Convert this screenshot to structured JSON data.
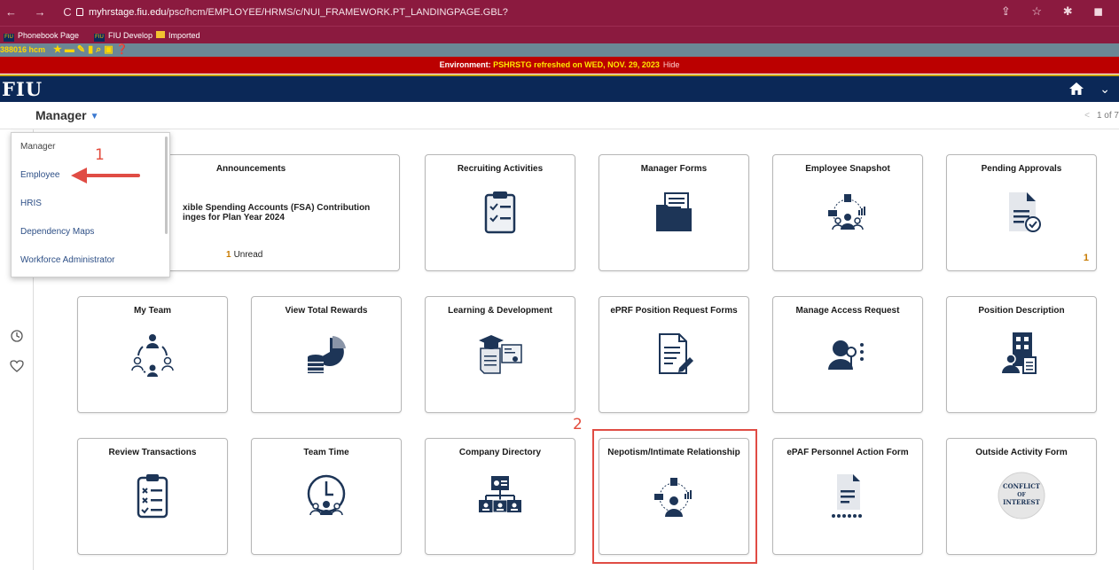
{
  "browser": {
    "nav": "← → C",
    "url_host": "myhrstage.fiu.edu",
    "url_path": "/psc/hcm/EMPLOYEE/HRMS/c/NUI_FRAMEWORK.PT_LANDINGPAGE.GBL?",
    "actions": "⇪ ☆ ✱ ◼",
    "bookmarks": [
      {
        "label": "Phonebook Page",
        "icon": "fiu-icon"
      },
      {
        "label": "FIU Develop",
        "icon": "fiu-icon"
      },
      {
        "label": "Imported",
        "icon": "folder-icon"
      }
    ],
    "bookmark_icon_text": "FIU"
  },
  "helper": {
    "user": "388016 hcm"
  },
  "environment": {
    "prefix": "Environment: ",
    "value": "PSHRSTG refreshed on WED, NOV. 29, 2023",
    "hide": "Hide"
  },
  "header": {
    "logo": "FIU"
  },
  "subheader": {
    "title": "Manager",
    "pager": "1 of 7"
  },
  "menu": {
    "items": [
      "Manager",
      "Employee",
      "HRIS",
      "Dependency Maps",
      "Workforce Administrator"
    ]
  },
  "tiles": {
    "announcements": {
      "title": "Announcements",
      "line1": "xible Spending Accounts (FSA) Contribution",
      "line2": "inges for Plan Year 2024",
      "unread_count": "1",
      "unread_label": "Unread"
    },
    "recruiting": {
      "title": "Recruiting Activities"
    },
    "manager_forms": {
      "title": "Manager Forms"
    },
    "employee_snapshot": {
      "title": "Employee Snapshot"
    },
    "pending_approvals": {
      "title": "Pending Approvals",
      "count": "1"
    },
    "my_team": {
      "title": "My Team"
    },
    "total_rewards": {
      "title": "View Total Rewards"
    },
    "learning": {
      "title": "Learning & Development"
    },
    "eprf": {
      "title": "ePRF Position Request Forms"
    },
    "access_request": {
      "title": "Manage Access Request"
    },
    "position_description": {
      "title": "Position Description"
    },
    "review_transactions": {
      "title": "Review Transactions"
    },
    "team_time": {
      "title": "Team Time"
    },
    "company_directory": {
      "title": "Company Directory"
    },
    "nepotism": {
      "title": "Nepotism/Intimate Relationship"
    },
    "epaf": {
      "title": "ePAF Personnel Action Form"
    },
    "outside_activity": {
      "title": "Outside Activity Form",
      "badge_line1": "CONFLICT",
      "badge_line2": "OF",
      "badge_line3": "INTEREST"
    }
  },
  "annotations": {
    "step1": "1",
    "step2": "2"
  },
  "colors": {
    "browser": "#8b1a3f",
    "env_banner": "#bb0000",
    "header": "#0b2857",
    "icon": "#1d3557",
    "annotation": "#e04c44",
    "count": "#c77a00"
  }
}
